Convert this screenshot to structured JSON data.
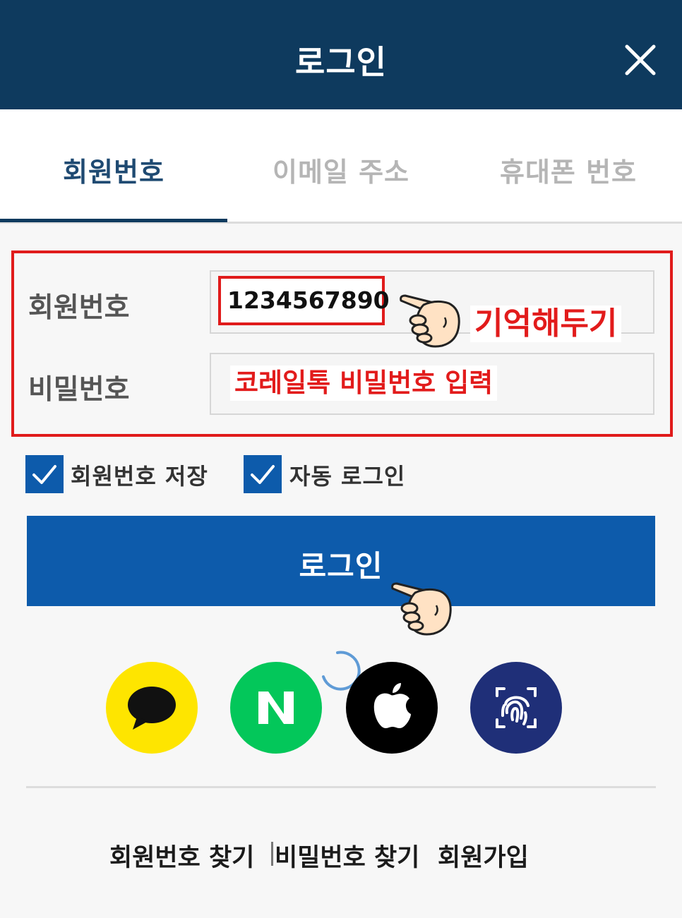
{
  "header": {
    "title": "로그인",
    "close_icon": "close-icon"
  },
  "tabs": [
    {
      "label": "회원번호",
      "active": true
    },
    {
      "label": "이메일 주소",
      "active": false
    },
    {
      "label": "휴대폰 번호",
      "active": false
    }
  ],
  "form": {
    "member_number_label": "회원번호",
    "member_number_value": "1234567890",
    "password_label": "비밀번호"
  },
  "annotations": {
    "remember": "기억해두기",
    "password_hint": "코레일톡 비밀번호 입력"
  },
  "options": {
    "save_member_number": {
      "label": "회원번호 저장",
      "checked": true
    },
    "auto_login": {
      "label": "자동 로그인",
      "checked": true
    }
  },
  "login_button": {
    "label": "로그인"
  },
  "social_login": [
    {
      "icon": "kakao-icon",
      "color": "#fee500"
    },
    {
      "icon": "naver-icon",
      "color": "#03c75a"
    },
    {
      "icon": "apple-icon",
      "color": "#000000"
    },
    {
      "icon": "fingerprint-icon",
      "color": "#1f2f78"
    }
  ],
  "footer": {
    "find_member_number": "회원번호 찾기",
    "find_password": "비밀번호 찾기",
    "sign_up": "회원가입"
  },
  "colors": {
    "header_bg": "#0e3a5e",
    "primary": "#0d5bab",
    "annotation_red": "#e01b1b"
  }
}
